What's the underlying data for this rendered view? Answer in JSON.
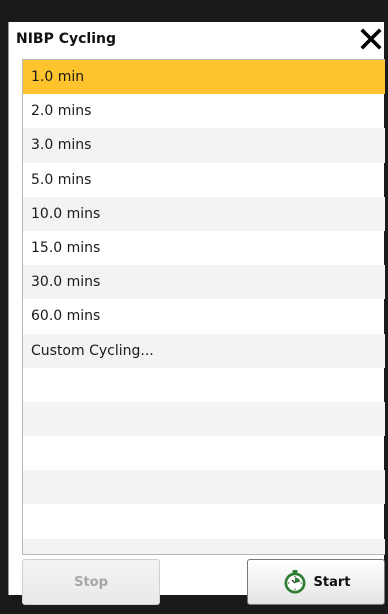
{
  "dialog": {
    "title": "NIBP Cycling",
    "close_icon": "close-icon"
  },
  "list": {
    "items": [
      {
        "label": "1.0 min",
        "selected": true
      },
      {
        "label": "2.0 mins",
        "selected": false
      },
      {
        "label": "3.0 mins",
        "selected": false
      },
      {
        "label": "5.0 mins",
        "selected": false
      },
      {
        "label": "10.0 mins",
        "selected": false
      },
      {
        "label": "15.0 mins",
        "selected": false
      },
      {
        "label": "30.0 mins",
        "selected": false
      },
      {
        "label": "60.0 mins",
        "selected": false
      },
      {
        "label": "Custom Cycling...",
        "selected": false
      }
    ],
    "selected_color": "#fec42d",
    "alt_row_color": "#f3f3f3"
  },
  "buttons": {
    "stop_label": "Stop",
    "start_label": "Start",
    "start_icon": "stopwatch-icon",
    "icon_color": "#2e7d32"
  }
}
